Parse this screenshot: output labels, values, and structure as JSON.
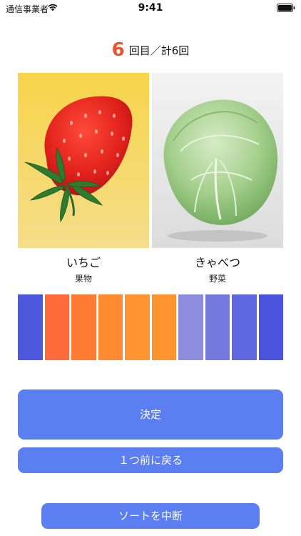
{
  "status_bar": {
    "carrier": "通信事業者",
    "time": "9:41"
  },
  "counter": {
    "current": "6",
    "text": "回目／計6回"
  },
  "items": [
    {
      "name": "いちご",
      "category": "果物",
      "icon": "strawberry-image"
    },
    {
      "name": "きゃべつ",
      "category": "野菜",
      "icon": "cabbage-image"
    }
  ],
  "color_bars": [
    "#4b57dc",
    "#ff6a3a",
    "#ff7a33",
    "#ff8a30",
    "#ff9330",
    "#ff932d",
    "#8c8ddc",
    "#7379df",
    "#5e66e0",
    "#4a53dc"
  ],
  "buttons": {
    "decide": "決定",
    "back": "１つ前に戻る",
    "stop": "ソートを中断"
  },
  "colors": {
    "accent": "#5b7ef0",
    "counter": "#e8542f"
  }
}
